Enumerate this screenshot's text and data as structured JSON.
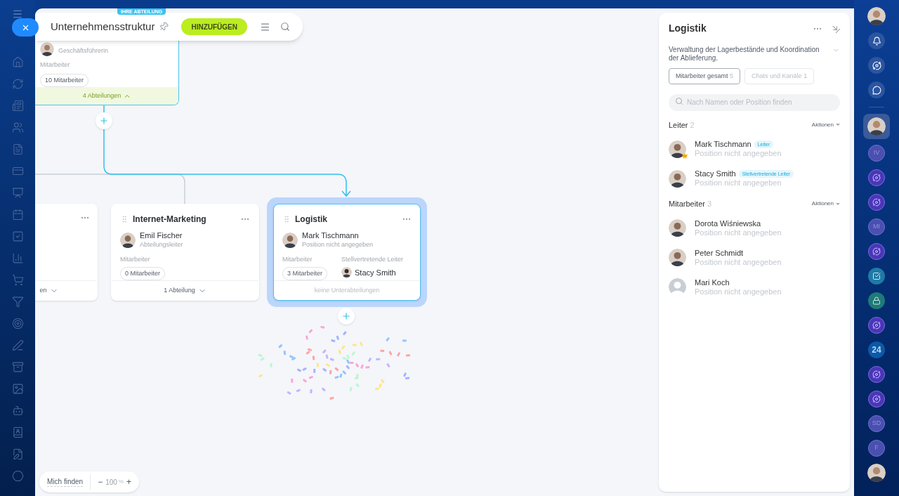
{
  "header": {
    "title": "Unternehmensstruktur",
    "add_button": "HINZUFÜGEN"
  },
  "root_card": {
    "badge": "IHRE ABTEILUNG",
    "head_position": "Geschäftsführerin",
    "employees_label": "Mitarbeiter",
    "employees_count": "10 Mitarbeiter",
    "subdepartments": "4 Abteilungen",
    "expanded": true
  },
  "cards": [
    {
      "kind": "cut",
      "footer": "en",
      "expanded": false,
      "selected": false
    },
    {
      "kind": "full",
      "title": "Internet-Marketing",
      "head_name": "Emil Fischer",
      "head_position": "Abteilungsleiter",
      "employees_label": "Mitarbeiter",
      "employees_count": "0 Mitarbeiter",
      "footer": "1 Abteilung",
      "expanded": false,
      "selected": false
    },
    {
      "kind": "full",
      "title": "Logistik",
      "head_name": "Mark Tischmann",
      "head_position": "Position nicht angegeben",
      "employees_label": "Mitarbeiter",
      "employees_count": "3 Mitarbeiter",
      "deputy_label": "Stellvertretende Leiter",
      "deputy_name": "Stacy Smith",
      "footer": "keine Unterabteilungen",
      "selected": true
    }
  ],
  "zoom_bar": {
    "find_me": "Mich finden",
    "minus": "−",
    "value": "100",
    "unit": "%",
    "plus": "+"
  },
  "panel": {
    "title": "Logistik",
    "description": "Verwaltung der Lagerbestände und Koordination der Ablieferung.",
    "tabs": [
      {
        "label": "Mitarbeiter gesamt",
        "count": "5",
        "selected": true
      },
      {
        "label": "Chats und Kanäle",
        "count": "1",
        "selected": false
      }
    ],
    "search": {
      "placeholder": "Nach Namen oder Position finden"
    },
    "groups": [
      {
        "title": "Leiter",
        "count": "2",
        "action": "Aktionen",
        "members": [
          {
            "name": "Mark Tischmann",
            "position": "Position nicht angegeben",
            "badge": "Leiter",
            "crown": true,
            "photo": true
          },
          {
            "name": "Stacy Smith",
            "position": "Position nicht angegeben",
            "badge": "Stellvertretende Leiter",
            "crown": false,
            "photo": true
          }
        ]
      },
      {
        "title": "Mitarbeiter",
        "count": "3",
        "action": "Aktionen",
        "members": [
          {
            "name": "Dorota Wiśniewska",
            "position": "Position nicht angegeben",
            "crown": false,
            "photo": true
          },
          {
            "name": "Peter Schmidt",
            "position": "Position nicht angegeben",
            "crown": false,
            "photo": true
          },
          {
            "name": "Mari Koch",
            "position": "Position nicht angegeben",
            "crown": false,
            "photo": false
          }
        ]
      }
    ]
  },
  "right_rail": {
    "top": [
      {
        "kind": "avatar"
      },
      {
        "kind": "bell"
      },
      {
        "kind": "copilot"
      },
      {
        "kind": "chat"
      }
    ],
    "chats": [
      {
        "kind": "avatar",
        "selected": true
      },
      {
        "kind": "initials",
        "text": "IV",
        "selected": false
      },
      {
        "kind": "swirl",
        "selected": false
      },
      {
        "kind": "swirl",
        "selected": false
      },
      {
        "kind": "initials",
        "text": "MI",
        "selected": false
      },
      {
        "kind": "swirl",
        "selected": false
      },
      {
        "kind": "task",
        "selected": false
      },
      {
        "kind": "lock",
        "selected": false
      },
      {
        "kind": "swirl",
        "selected": false
      },
      {
        "kind": "logo",
        "text": "24",
        "selected": false
      },
      {
        "kind": "swirl",
        "selected": false
      },
      {
        "kind": "swirl",
        "selected": false
      },
      {
        "kind": "initials",
        "text": "SD",
        "selected": false
      },
      {
        "kind": "initials",
        "text": "F",
        "selected": false
      },
      {
        "kind": "avatar",
        "selected": false
      }
    ]
  }
}
